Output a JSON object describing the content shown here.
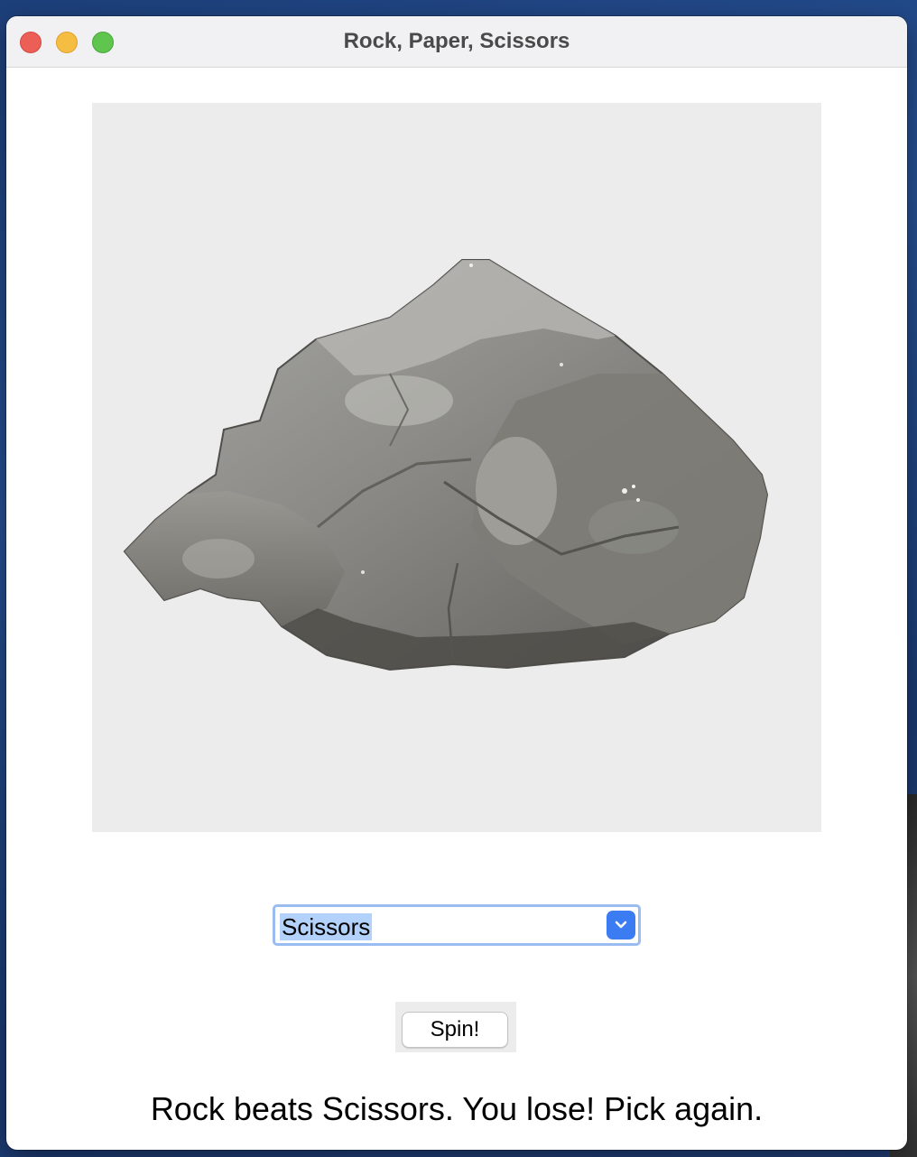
{
  "window": {
    "title": "Rock, Paper, Scissors"
  },
  "display": {
    "image_subject": "rock"
  },
  "choice_select": {
    "selected": "Scissors"
  },
  "spin_button": {
    "label": "Spin!"
  },
  "result": {
    "message": "Rock beats Scissors. You lose! Pick again."
  },
  "colors": {
    "accent": "#3b7cf2",
    "selection_highlight": "#b3d2fb",
    "close": "#ec5f57",
    "minimize": "#f6bd43",
    "maximize": "#5fc54f"
  }
}
